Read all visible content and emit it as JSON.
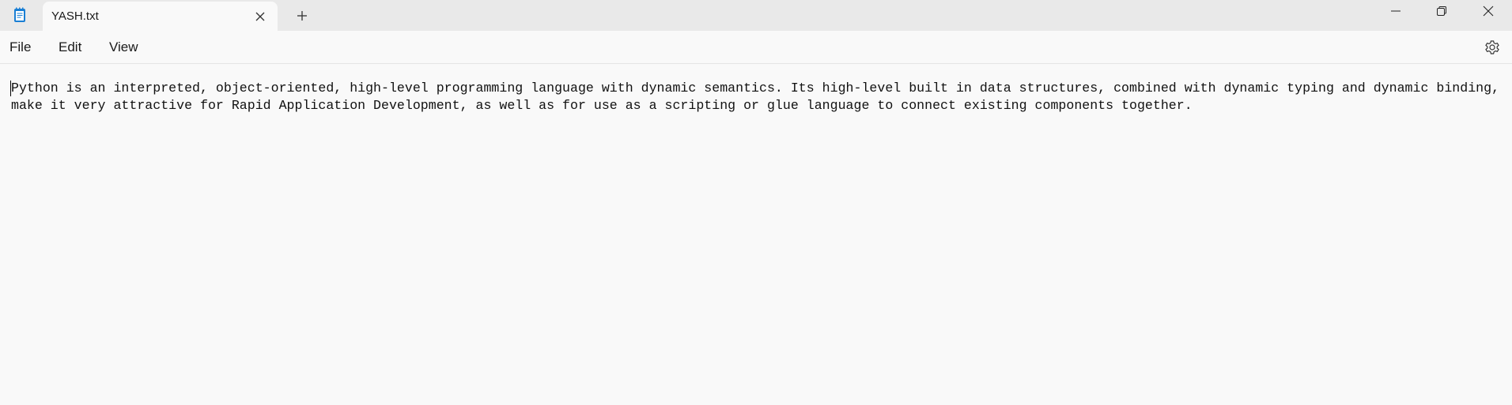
{
  "tab": {
    "title": "YASH.txt"
  },
  "menu": {
    "file": "File",
    "edit": "Edit",
    "view": "View"
  },
  "icons": {
    "app": "notepad-icon",
    "tab_close": "close-icon",
    "new_tab": "plus-icon",
    "minimize": "minimize-icon",
    "maximize": "restore-icon",
    "close": "close-icon",
    "settings": "gear-icon"
  },
  "colors": {
    "titlebar": "#e9e9e9",
    "background": "#f9f9f9",
    "text": "#111111",
    "app_icon_accent": "#1a7fd4"
  },
  "document": {
    "lines": [
      "Python is an interpreted, object-oriented, high-level programming language with dynamic semantics. Its high-level built in data structures, combined with dynamic typing and dynamic binding,",
      "make it very attractive for Rapid Application Development, as well as for use as a scripting or glue language to connect existing components together."
    ]
  }
}
